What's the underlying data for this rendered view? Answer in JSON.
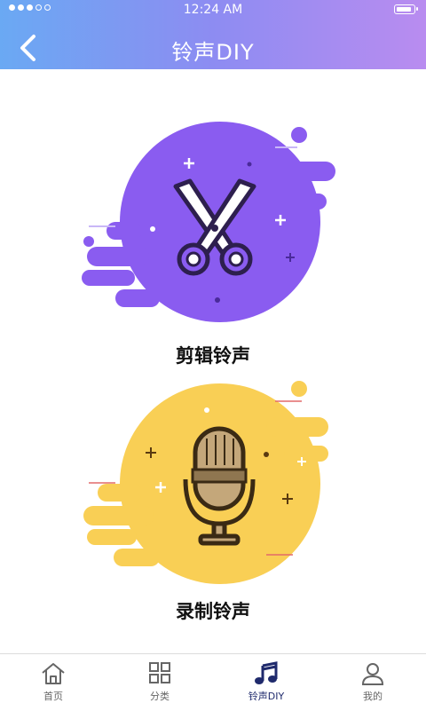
{
  "status_bar": {
    "time": "12:24 AM"
  },
  "header": {
    "title": "铃声DIY"
  },
  "actions": [
    {
      "label": "剪辑铃声",
      "icon": "scissors-icon",
      "color": "#8a5cf0"
    },
    {
      "label": "录制铃声",
      "icon": "microphone-icon",
      "color": "#f9cf55"
    }
  ],
  "tabbar": {
    "items": [
      {
        "label": "首页",
        "icon": "home-icon"
      },
      {
        "label": "分类",
        "icon": "grid-icon"
      },
      {
        "label": "铃声DIY",
        "icon": "music-note-icon",
        "active": true
      },
      {
        "label": "我的",
        "icon": "user-icon"
      }
    ]
  },
  "colors": {
    "header_start": "#6aa9f3",
    "header_end": "#b98cf0",
    "active_tab": "#1f2a6c"
  }
}
